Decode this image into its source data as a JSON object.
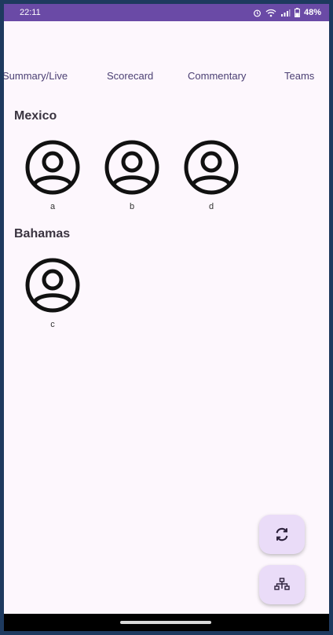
{
  "status_bar": {
    "time": "22:11",
    "battery": "48%",
    "icons": [
      "alarm-icon",
      "wifi-icon",
      "signal-icon",
      "battery-icon"
    ]
  },
  "tabs": [
    {
      "label": "Summary/Live"
    },
    {
      "label": "Scorecard"
    },
    {
      "label": "Commentary"
    },
    {
      "label": "Teams"
    }
  ],
  "teams": [
    {
      "name": "Mexico",
      "players": [
        {
          "name": "a"
        },
        {
          "name": "b"
        },
        {
          "name": "d"
        }
      ]
    },
    {
      "name": "Bahamas",
      "players": [
        {
          "name": "c"
        }
      ]
    }
  ],
  "fabs": [
    {
      "icon": "refresh-icon"
    },
    {
      "icon": "hierarchy-icon"
    }
  ],
  "colors": {
    "status_bar": "#6a4aa6",
    "background": "#fdf7fd",
    "fab": "#eadcf8",
    "tab_text": "#4b3f73"
  }
}
